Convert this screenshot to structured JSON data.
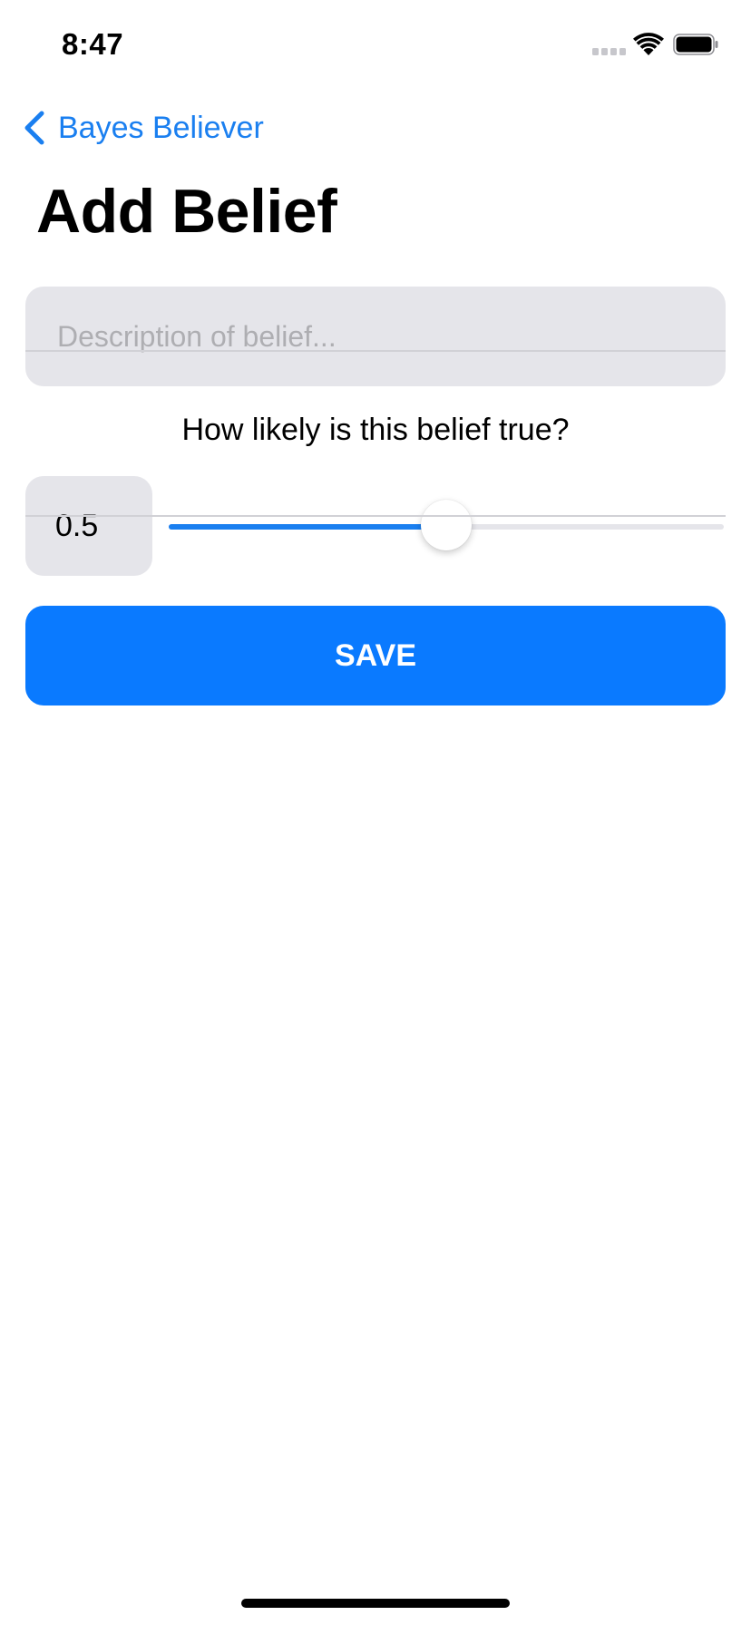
{
  "status_bar": {
    "time": "8:47"
  },
  "nav": {
    "back_label": "Bayes Believer",
    "back_icon": "chevron-left-icon"
  },
  "title": "Add Belief",
  "description_field": {
    "value": "",
    "placeholder": "Description of belief..."
  },
  "likelihood": {
    "question": "How likely is this belief true?",
    "value_text": "0.5",
    "slider_value": 0.5,
    "slider_min": 0,
    "slider_max": 1
  },
  "save_button": {
    "label": "SAVE"
  },
  "colors": {
    "accent": "#0a7aff",
    "field_background": "#e5e5ea",
    "placeholder": "#aeaeb2"
  }
}
